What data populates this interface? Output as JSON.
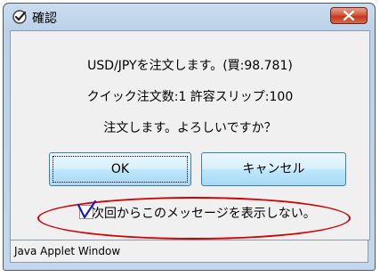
{
  "window": {
    "title": "確認",
    "icon": "check-mark-icon",
    "close_icon": "close-icon"
  },
  "message": {
    "line1": "USD/JPYを注文します。(買:98.781)",
    "line2": "クイック注文数:1 許容スリップ:100",
    "line3": "注文します。よろしいですか？"
  },
  "buttons": {
    "ok_label": "OK",
    "cancel_label": "キャンセル"
  },
  "checkbox": {
    "label": "次回からこのメッセージを表示しない。",
    "checked": true
  },
  "status_bar": {
    "text": "Java Applet Window"
  },
  "colors": {
    "annotation_ellipse": "#d40000",
    "check_mark": "#1a1ad0",
    "close_button": "#c4371e"
  }
}
